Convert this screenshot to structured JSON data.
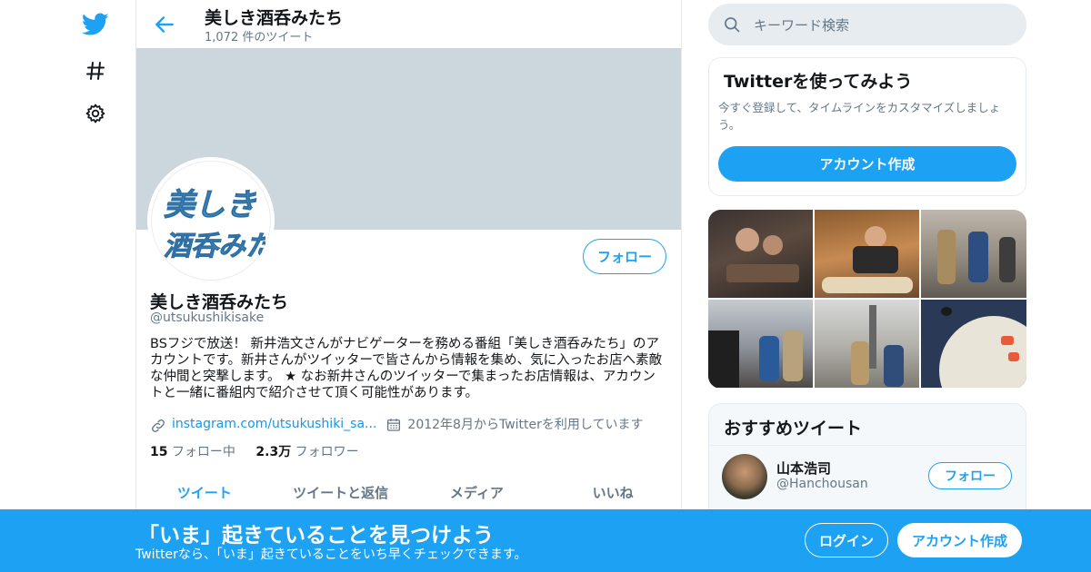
{
  "nav": {
    "icons": [
      "twitter-bird-icon",
      "hashtag-icon",
      "gear-icon"
    ]
  },
  "header": {
    "title": "美しき酒呑みたち",
    "tweet_count": "1,072 件のツイート"
  },
  "profile": {
    "avatar_text": "美しき 酒呑みたち",
    "follow_label": "フォロー",
    "name": "美しき酒呑みたち",
    "handle": "@utsukushikisake",
    "bio": "BSフジで放送！ 新井浩文さんがナビゲーターを務める番組「美しき酒呑みたち」のアカウントです。新井さんがツイッターで皆さんから情報を集め、気に入ったお店へ素敵な仲間と突撃します。 ★ なお新井さんのツイッターで集まったお店情報は、アカウントと一緒に番組内で紹介させて頂く可能性があります。",
    "link": "instagram.com/utsukushiki_sa...",
    "joined": "2012年8月からTwitterを利用しています",
    "following_count": "15",
    "following_label": "フォロー中",
    "followers_count": "2.3万",
    "followers_label": "フォロワー"
  },
  "tabs": [
    {
      "label": "ツイート"
    },
    {
      "label": "ツイートと返信"
    },
    {
      "label": "メディア"
    },
    {
      "label": "いいね"
    }
  ],
  "search": {
    "placeholder": "キーワード検索"
  },
  "signup_card": {
    "title": "Twitterを使ってみよう",
    "subtitle": "今すぐ登録して、タイムラインをカスタマイズしましょう。",
    "button": "アカウント作成"
  },
  "recommended": {
    "title": "おすすめツイート",
    "user": {
      "name": "山本浩司",
      "handle": "@Hanchousan",
      "follow_label": "フォロー"
    }
  },
  "bottom_bar": {
    "title": "「いま」起きていることを見つけよう",
    "subtitle": "Twitterなら、「いま」起きていることをいち早くチェックできます。",
    "login": "ログイン",
    "signup": "アカウント作成"
  },
  "colors": {
    "accent": "#1da1f2",
    "banner": "#ccd6dd",
    "muted": "#657786"
  }
}
